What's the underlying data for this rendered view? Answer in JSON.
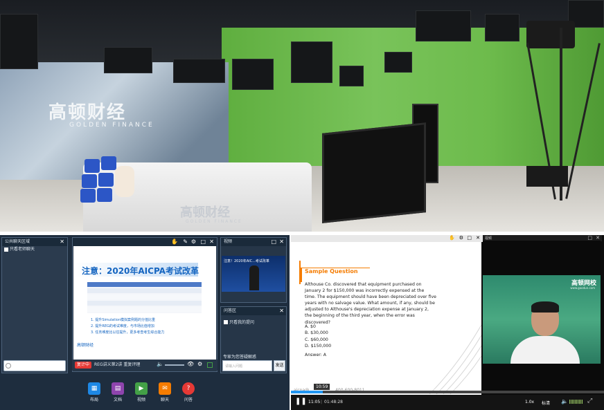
{
  "studio": {
    "logo_cn": "高顿财经",
    "logo_en": "GOLDEN FINANCE",
    "desk_logo_cn": "高顿财经",
    "desk_logo_en": "GOLDEN FINANCE"
  },
  "client": {
    "chat_panel": {
      "title": "公共聊天区域",
      "checkbox_label": "只看老师聊天"
    },
    "slide": {
      "title": "注意：2020年AICPA考试改革",
      "points": [
        "1. 提升Simulation模拟案例题的分值比重",
        "2. 提升REG的考试难度，与市场比值增加",
        "3. 任务难度比以往提升，更多考查考生综合能力"
      ],
      "footer_logo": "高顿财经"
    },
    "video_panel": {
      "title": "视频",
      "thumb_title": "注意！2020年AIC...考试改革"
    },
    "qa_panel": {
      "title": "问答区",
      "checkbox_label": "只看我的提问",
      "hint": "专家为您答疑解惑",
      "input_placeholder": "请输入问题",
      "send_label": "发送"
    },
    "status": {
      "badge": "复计中",
      "message": "REG讲义第2讲 重复评理"
    },
    "toolbar": [
      {
        "label": "布局",
        "color": "#1e88e5",
        "icon": "layout-icon"
      },
      {
        "label": "文档",
        "color": "#8e44ad",
        "icon": "document-icon"
      },
      {
        "label": "视频",
        "color": "#43a047",
        "icon": "video-icon"
      },
      {
        "label": "聊天",
        "color": "#f57c00",
        "icon": "chat-icon"
      },
      {
        "label": "问答",
        "color": "#e53935",
        "icon": "question-icon"
      }
    ]
  },
  "player": {
    "question_heading": "Sample Question",
    "question_text": "Althouse Co. discovered that equipment purchased on January 2 for $150,000 was incorrectly expensed at the time. The equipment should have been depreciated over five years with no salvage value. What amount, if any, should be adjusted to Althouse's depreciation expense at January 2, the beginning of the third year, when the error was discovered?",
    "options": [
      "A. $0",
      "B. $30,000",
      "C. $60,000",
      "D. $150,000"
    ],
    "answer": "Answer: A",
    "footer_contact": "400-600-8011",
    "footer_email": "aicpa@",
    "teacher_panel_title": "视频",
    "teacher_logo": "高顿网校",
    "teacher_logo_sub": "www.gaodun.com",
    "tooltip_time": "10:59",
    "current_time": "11:05",
    "total_time": "01:48:28",
    "speed": "1.0x",
    "quality": "标清",
    "progress_fraction": 0.102
  }
}
